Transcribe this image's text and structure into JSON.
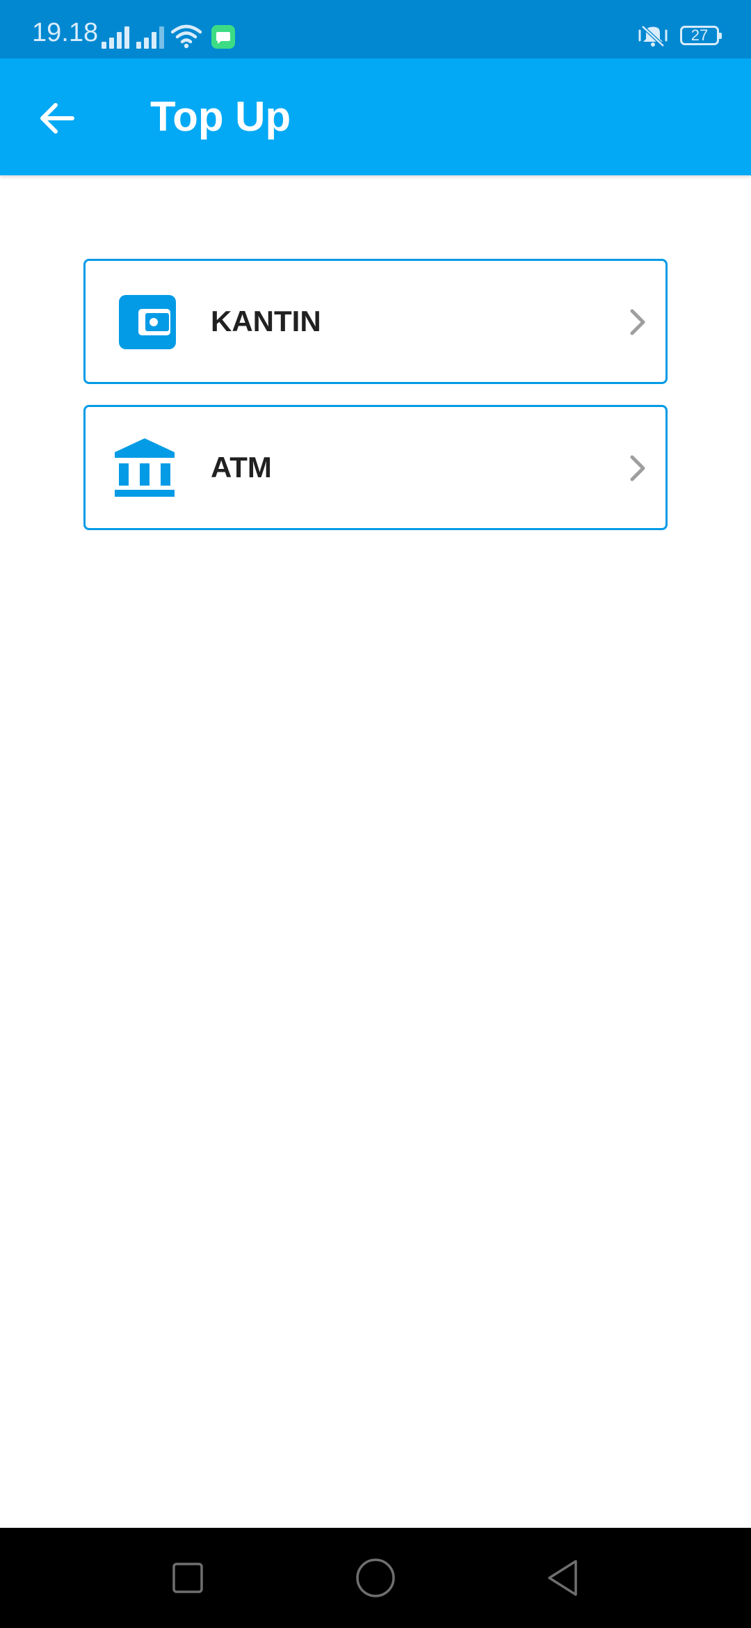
{
  "status_bar": {
    "time": "19.18",
    "battery_level": "27",
    "icons": [
      "signal-icon",
      "signal-icon",
      "wifi-icon",
      "message-icon",
      "vibrate-icon",
      "battery-icon"
    ]
  },
  "app_bar": {
    "title": "Top Up",
    "back_icon": "arrow-left-icon"
  },
  "options": [
    {
      "label": "KANTIN",
      "icon": "wallet-icon"
    },
    {
      "label": "ATM",
      "icon": "bank-icon"
    }
  ],
  "nav_bar": {
    "buttons": [
      "recents-icon",
      "home-icon",
      "back-triangle-icon"
    ]
  },
  "colors": {
    "status_bar": "#0288d1",
    "app_bar": "#03a9f4",
    "accent": "#039be5",
    "label_text": "#212121",
    "chevron": "#9e9e9e"
  }
}
